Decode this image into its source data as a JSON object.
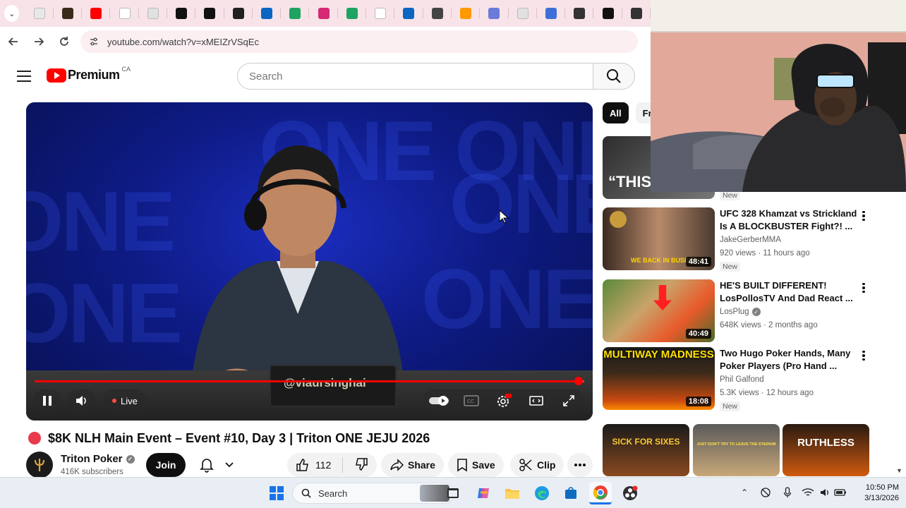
{
  "browser": {
    "url": "youtube.com/watch?v=xMEIZrVSqEc",
    "tabs": [
      {
        "icon": "blank-page-icon",
        "color": "#e8e8e8"
      },
      {
        "icon": "tab-favicon-dark-icon",
        "color": "#3a2a1a"
      },
      {
        "icon": "youtube-icon",
        "color": "#ff0000"
      },
      {
        "icon": "openai-icon",
        "color": "#ffffff"
      },
      {
        "icon": "generic-circle-icon",
        "color": "#e0e0e0"
      },
      {
        "icon": "threads-icon",
        "color": "#111111"
      },
      {
        "icon": "medium-icon",
        "color": "#111111"
      },
      {
        "icon": "mail-icon",
        "color": "#202020"
      },
      {
        "icon": "linkedin-icon",
        "color": "#0a66c2"
      },
      {
        "icon": "sheets-plus-icon",
        "color": "#1ea362"
      },
      {
        "icon": "instagram-icon",
        "color": "#d62976"
      },
      {
        "icon": "sheets-plus-icon",
        "color": "#1ea362"
      },
      {
        "icon": "cloud-icon",
        "color": "#ffffff"
      },
      {
        "icon": "linkedin-icon",
        "color": "#0a66c2"
      },
      {
        "icon": "building-icon",
        "color": "#444444"
      },
      {
        "icon": "amazon-icon",
        "color": "#ff9900"
      },
      {
        "icon": "compass-icon",
        "color": "#6a7bd8"
      },
      {
        "icon": "generic-circle-icon",
        "color": "#e0e0e0"
      },
      {
        "icon": "bowl-icon",
        "color": "#3e6fd8"
      },
      {
        "icon": "swirl-icon",
        "color": "#333333"
      },
      {
        "icon": "wikipedia-icon",
        "color": "#111111"
      },
      {
        "icon": "chat-icon",
        "color": "#333333"
      }
    ]
  },
  "header": {
    "logo_text": "Premium",
    "logo_region": "CA",
    "search_placeholder": "Search"
  },
  "player": {
    "overlay_text": "@viaursinghai",
    "live_label": "Live",
    "progress_fraction": 0.99
  },
  "video": {
    "title": "$8K NLH Main Event – Event #10, Day 3 | Triton ONE JEJU 2026",
    "channel": "Triton Poker",
    "subscribers": "416K subscribers",
    "join_label": "Join",
    "like_count": "112",
    "share_label": "Share",
    "save_label": "Save",
    "clip_label": "Clip"
  },
  "chips": [
    {
      "label": "All",
      "active": true
    },
    {
      "label": "Fr",
      "active": false
    }
  ],
  "recommendations": [
    {
      "title_line1": "",
      "title_line2": "",
      "channel": "",
      "stats": "",
      "new_badge": "New",
      "duration": "",
      "thumb_text": "“THIS"
    },
    {
      "title_line1": "UFC 328 Khamzat vs Strickland",
      "title_line2": "Is A BLOCKBUSTER Fight?! ...",
      "channel": "JakeGerberMMA",
      "verified": false,
      "stats": "920 views · 11 hours ago",
      "new_badge": "New",
      "duration": "48:41",
      "thumb_text": "WE BACK IN BUSINESS"
    },
    {
      "title_line1": "HE'S BUILT DIFFERENT!",
      "title_line2": "LosPollosTV And Dad React ...",
      "channel": "LosPlug",
      "verified": true,
      "stats": "648K views · 2 months ago",
      "new_badge": "",
      "duration": "40:49",
      "thumb_text": ""
    },
    {
      "title_line1": "Two Hugo Poker Hands, Many",
      "title_line2": "Poker Players (Pro Hand ...",
      "channel": "Phil Galfond",
      "verified": false,
      "stats": "5.3K views · 12 hours ago",
      "new_badge": "New",
      "duration": "18:08",
      "thumb_text": "MULTIWAY MADNESS"
    }
  ],
  "shorts": [
    {
      "text": "SICK FOR SIXES"
    },
    {
      "text": "JUST DON'T TRY TO LEAVE THE STADIUM"
    },
    {
      "text": "RUTHLESS"
    }
  ],
  "taskbar": {
    "search_label": "Search",
    "time": "10:50 PM",
    "date": "3/13/2026"
  },
  "colors": {
    "youtube_red": "#ff0000",
    "tab_strip": "#f7e3e8",
    "player_blue": "#0e1b85"
  }
}
